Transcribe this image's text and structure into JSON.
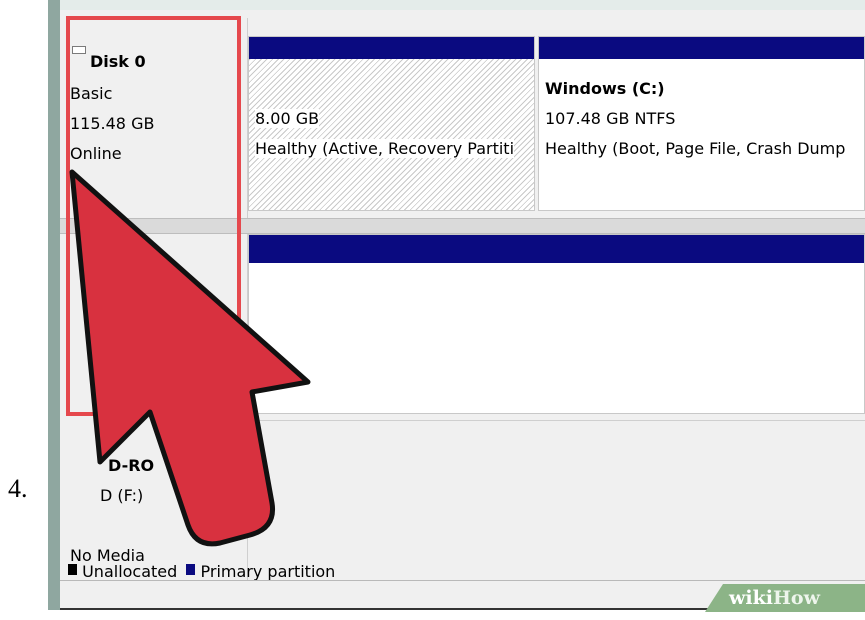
{
  "step": {
    "number": "4."
  },
  "disk0": {
    "name": "Disk 0",
    "type": "Basic",
    "size": "115.48 GB",
    "status": "Online"
  },
  "partitions": [
    {
      "name": "",
      "size": "8.00 GB",
      "status": "Healthy (Active, Recovery Partiti"
    },
    {
      "name": "Windows  (C:)",
      "size": "107.48 GB NTFS",
      "status": "Healthy (Boot, Page File, Crash Dump"
    }
  ],
  "cdrom": {
    "name": "D-RO",
    "drive": "D (F:)",
    "media": "No Media"
  },
  "legend": {
    "unallocated": "Unallocated",
    "primary": "Primary partition",
    "unallocated_color": "#000000",
    "primary_color": "#0a0a80"
  },
  "watermark": {
    "wiki": "wiki",
    "how": "How"
  },
  "colors": {
    "highlight": "#e5484d",
    "arrow": "#d8313f",
    "partition_header": "#0a0a80"
  }
}
